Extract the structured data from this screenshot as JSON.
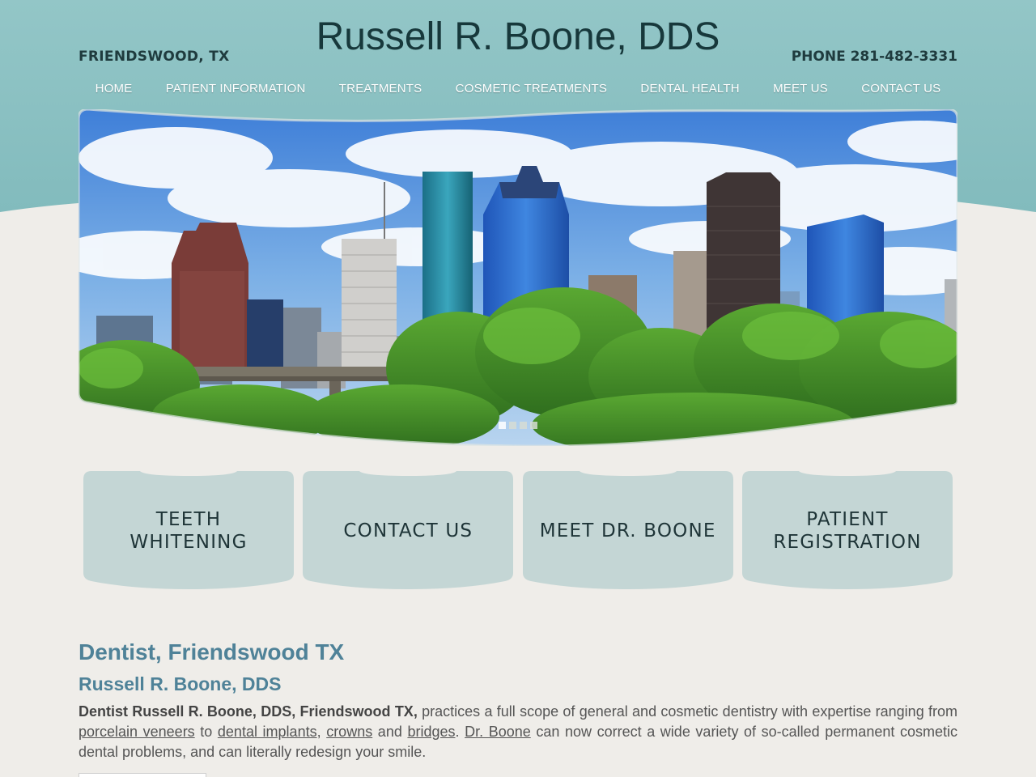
{
  "header": {
    "location": "FRIENDSWOOD, TX",
    "title": "Russell R. Boone, DDS",
    "phone": "PHONE 281-482-3331"
  },
  "nav": {
    "items": [
      {
        "label": "HOME"
      },
      {
        "label": "PATIENT INFORMATION"
      },
      {
        "label": "TREATMENTS"
      },
      {
        "label": "COSMETIC TREATMENTS"
      },
      {
        "label": "DENTAL HEALTH"
      },
      {
        "label": "MEET US"
      },
      {
        "label": "CONTACT US"
      }
    ]
  },
  "slider": {
    "slide_count": 4,
    "active_index": 0
  },
  "cards": [
    {
      "label": "TEETH\nWHITENING"
    },
    {
      "label": "CONTACT US"
    },
    {
      "label": "MEET DR. BOONE"
    },
    {
      "label": "PATIENT\nREGISTRATION"
    }
  ],
  "content": {
    "heading": "Dentist, Friendswood TX",
    "subheading": "Russell R. Boone, DDS",
    "lead_bold": "Dentist Russell R. Boone, DDS, Friendswood TX,",
    "text_1": " practices a full scope of general and cosmetic dentistry with expertise ranging from ",
    "link_veneers": "porcelain veneers",
    "text_2": " to ",
    "link_implants": "dental implants",
    "text_3": ", ",
    "link_crowns": "crowns",
    "text_4": " and ",
    "link_bridges": "bridges",
    "text_5": ". ",
    "link_boone": "Dr. Boone",
    "text_6": " can now correct a wide variety of so-called permanent cosmetic dental problems, and can literally redesign your smile."
  },
  "colors": {
    "header_teal": "#8fc3c5",
    "card_fill": "#c4d6d5",
    "heading_blue": "#4f8298",
    "page_bg": "#efede9"
  }
}
